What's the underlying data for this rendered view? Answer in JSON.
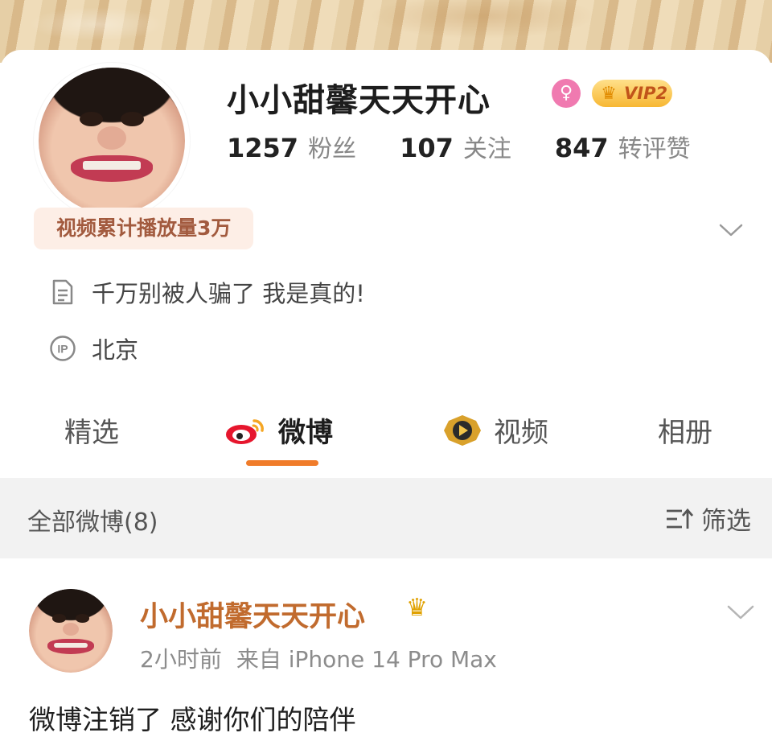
{
  "profile": {
    "name": "小小甜馨天天开心",
    "vip_label": "VIP2",
    "gender_icon": "female-symbol-icon",
    "stats": [
      {
        "num": "1257",
        "label": "粉丝"
      },
      {
        "num": "107",
        "label": "关注"
      },
      {
        "num": "847",
        "label": "转评赞"
      }
    ],
    "play_tag": "视频累计播放量3万",
    "bio": "千万别被人骗了 我是真的!",
    "ip_location": "北京",
    "colors": {
      "accent": "#f07c2a",
      "name_link": "#c16b2e",
      "vip_gold": "#f7b733"
    }
  },
  "tabs": [
    {
      "label": "精选"
    },
    {
      "label": "微博"
    },
    {
      "label": "视频"
    },
    {
      "label": "相册"
    }
  ],
  "filter_bar": {
    "all_label": "全部微博(8)",
    "filter_label": "筛选"
  },
  "post": {
    "author": "小小甜馨天天开心",
    "time": "2小时前",
    "source": "来自 iPhone 14 Pro Max",
    "text": "微博注销了 感谢你们的陪伴"
  }
}
